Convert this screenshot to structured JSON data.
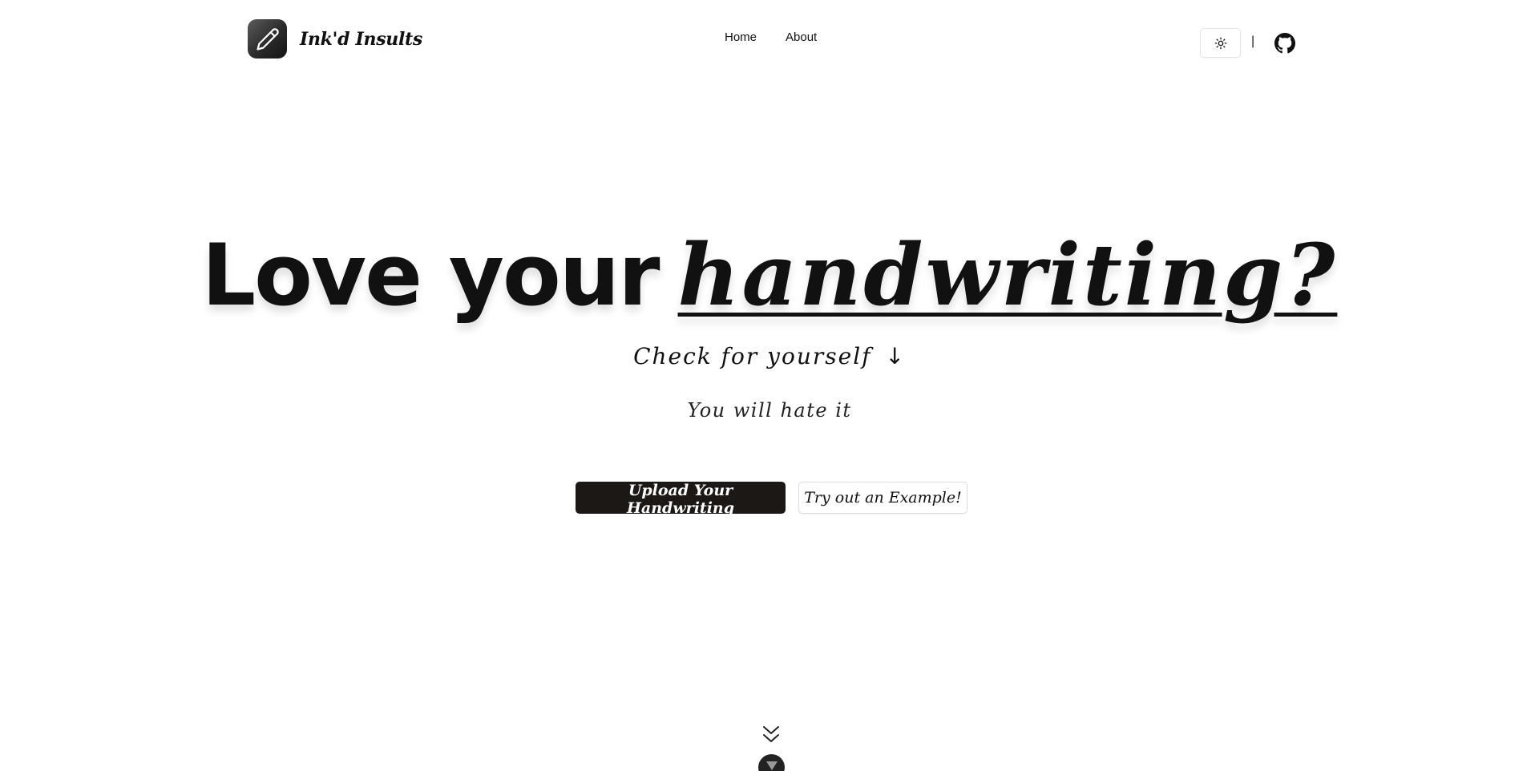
{
  "header": {
    "brand_name": "Ink'd Insults",
    "nav": [
      {
        "label": "Home"
      },
      {
        "label": "About"
      }
    ],
    "separator": "|",
    "theme_icon": "sun-icon",
    "github_icon": "github-icon",
    "logo_icon": "pencil-icon"
  },
  "hero": {
    "title_plain": "Love your",
    "title_accent": "handwriting?",
    "subtitle": "Check for yourself",
    "subtitle_arrow": "↓",
    "tagline": "You will hate it",
    "primary_button": "Upload Your Handwriting",
    "secondary_button": "Try out an Example!"
  },
  "scroll": {
    "icon": "double-chevron-down-icon",
    "knob_icon": "chevron-down-icon"
  },
  "colors": {
    "primary_button_bg": "#1b1816",
    "text": "#111111",
    "background": "#ffffff"
  }
}
